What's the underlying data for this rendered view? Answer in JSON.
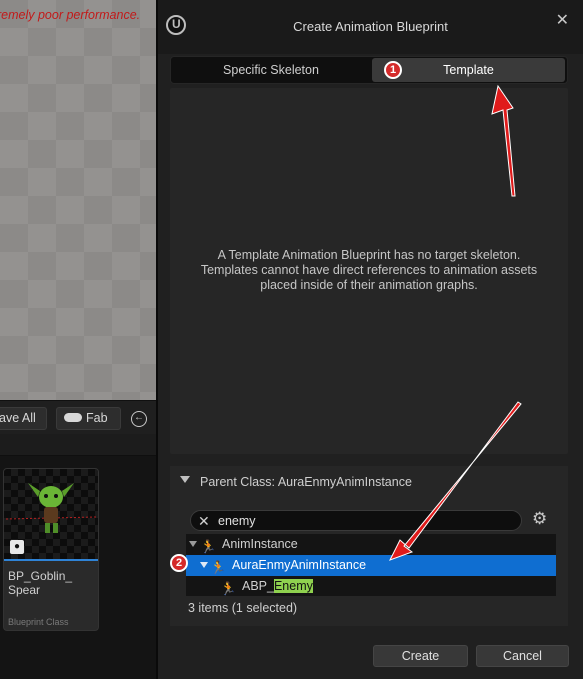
{
  "editor": {
    "viewport_warning": "remely poor performance.",
    "toolbar": {
      "save_all_label": "ave All",
      "fab_label": "Fab",
      "back_icon": "history-back-icon"
    },
    "asset": {
      "name": "BP_Goblin_\nSpear",
      "type": "Blueprint Class"
    }
  },
  "dialog": {
    "title": "Create Animation Blueprint",
    "tabs": [
      {
        "label": "Specific Skeleton",
        "selected": false
      },
      {
        "label": "Template",
        "selected": true
      }
    ],
    "template_description": "A Template Animation Blueprint has no target skeleton.\nTemplates cannot have direct references to animation assets\nplaced inside of their animation graphs.",
    "parent_class": {
      "header": "Parent Class: AuraEnmyAnimInstance",
      "search": {
        "value": "enemy",
        "placeholder": ""
      },
      "tree": [
        {
          "label": "AnimInstance",
          "expanded": true,
          "selected": false
        },
        {
          "label": "AuraEnmyAnimInstance",
          "expanded": true,
          "selected": true
        },
        {
          "label_prefix": "ABP_",
          "label_match": "Enemy",
          "selected": false
        }
      ],
      "items_count": "3 items (1 selected)"
    },
    "buttons": {
      "create": "Create",
      "cancel": "Cancel"
    }
  },
  "annotations": {
    "step_1": "1",
    "step_2": "2",
    "color": "#e01b1b"
  },
  "colors": {
    "selection": "#0f6ed1",
    "search_highlight": "#8fd14f",
    "warning_text": "#c21a1a"
  }
}
